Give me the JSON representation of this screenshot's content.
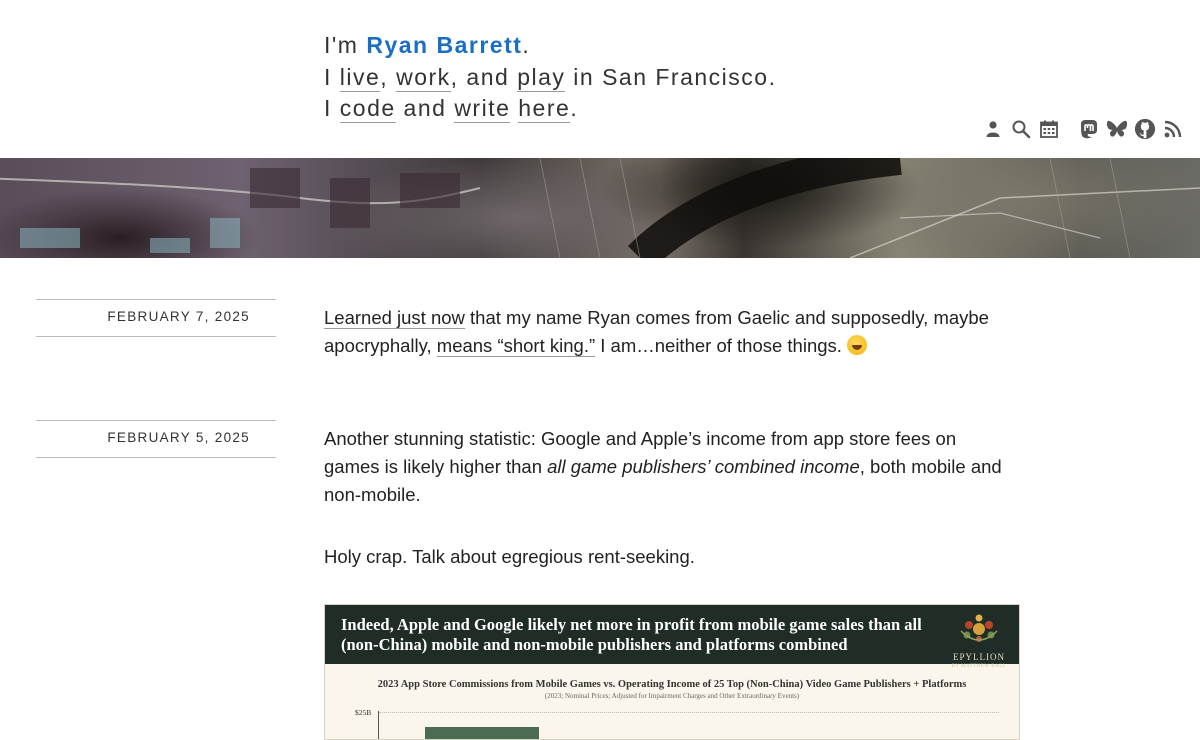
{
  "header": {
    "line1_prefix": "I'm ",
    "name": "Ryan Barrett",
    "line1_suffix": ".",
    "line2_a": "I ",
    "live": "live",
    "line2_b": ", ",
    "work": "work",
    "line2_c": ", and ",
    "play": "play",
    "line2_d": " in San Francisco.",
    "line3_a": "I ",
    "code": "code",
    "line3_b": " and ",
    "write": "write",
    "line3_c": " ",
    "here": "here",
    "line3_d": "."
  },
  "icons": [
    "person-icon",
    "search-icon",
    "calendar-icon",
    "mastodon-icon",
    "bluesky-icon",
    "github-icon",
    "rss-icon"
  ],
  "posts": [
    {
      "date": "FEBRUARY 7, 2025",
      "link1": "Learned just now",
      "text1": " that my name Ryan comes from Gaelic and supposedly, maybe apocryphally, ",
      "link2": "means “short king.”",
      "text2": " I am…neither of those things. "
    },
    {
      "date": "FEBRUARY 5, 2025",
      "p1a": "Another stunning statistic: Google and Apple’s income from app store fees on games is likely higher than ",
      "p1em": "all game publishers’ combined income",
      "p1b": ", both mobile and non-mobile.",
      "p2": "Holy crap. Talk about egregious rent-seeking."
    }
  ],
  "figure": {
    "headline": "Indeed, Apple and Google likely net more in profit from mobile game sales than all (non-China) mobile and non-mobile publishers and platforms combined",
    "logo_name": "EPYLLION",
    "logo_by": "BY MATTHEW BALL",
    "subtitle": "2023 App Store Commissions from Mobile Games vs. Operating Income of 25 Top (Non-China) Video Game Publishers + Platforms",
    "subtitle2": "(2023; Nominal Prices; Adjusted for Impairment Charges and Other Extraordinary Events)",
    "ytick": "$25B"
  },
  "colors": {
    "accent": "#1a6fc4",
    "figure_header": "#1f2d26",
    "figure_bar": "#4b6b52"
  }
}
